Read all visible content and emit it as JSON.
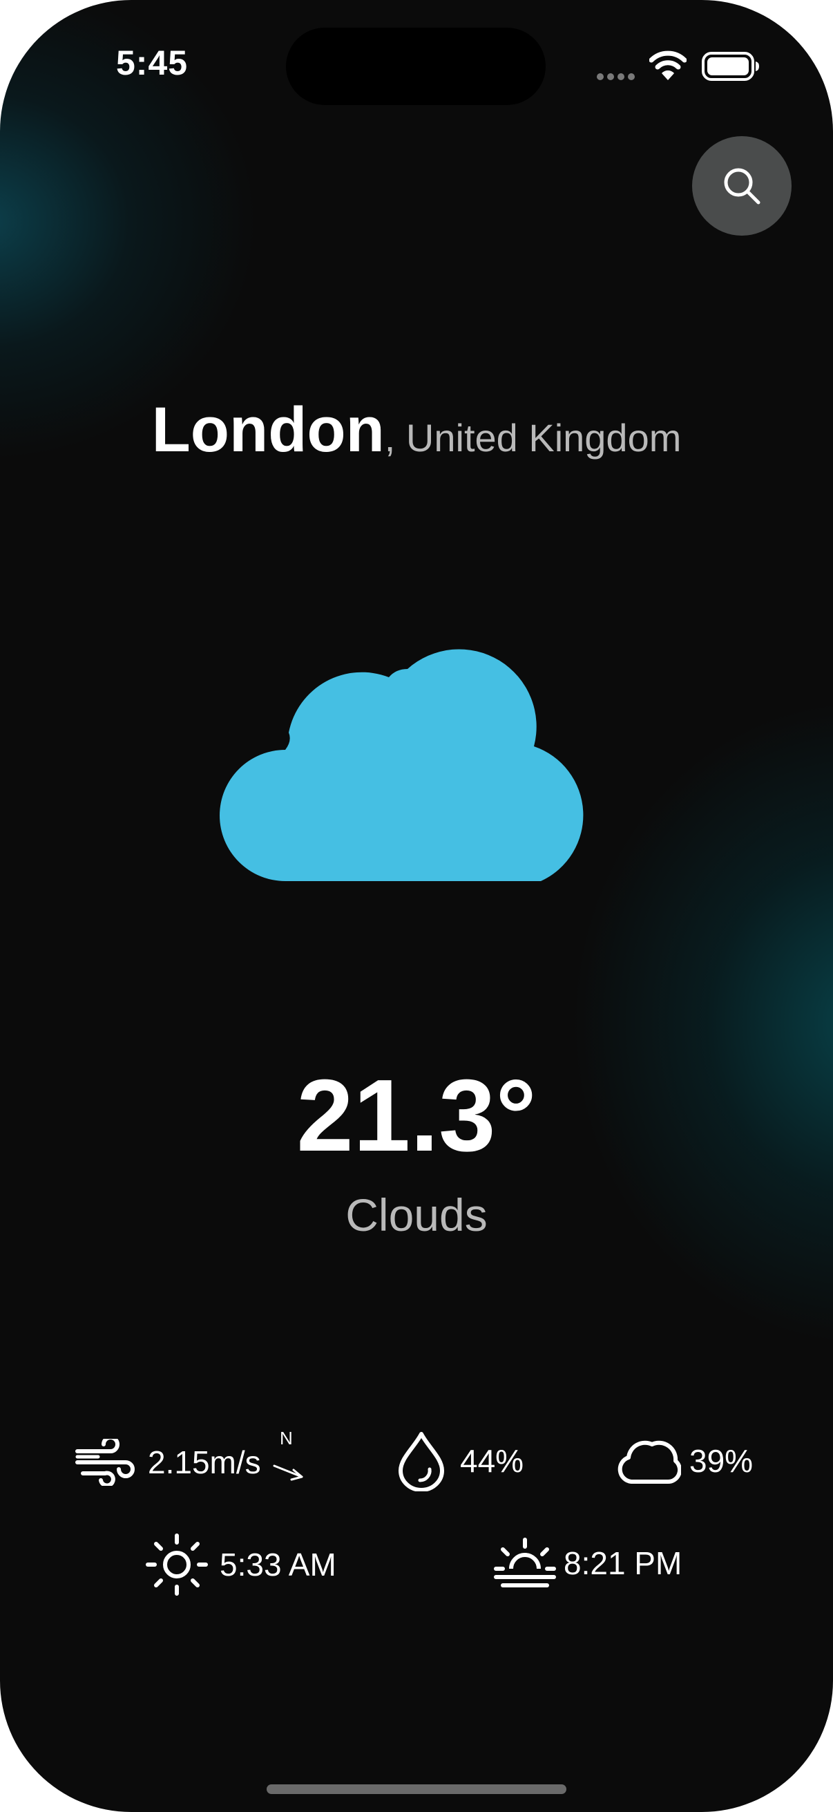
{
  "status_bar": {
    "time": "5:45"
  },
  "search": {
    "icon": "search-icon"
  },
  "location": {
    "city": "London",
    "separator": ",",
    "country": " United Kingdom"
  },
  "weather": {
    "icon": "cloud-icon",
    "temperature": "21.3°",
    "condition": "Clouds"
  },
  "stats": {
    "wind": {
      "icon": "wind-icon",
      "value": "2.15m/s",
      "direction_label": "N"
    },
    "humidity": {
      "icon": "droplet-icon",
      "value": "44%"
    },
    "cloudiness": {
      "icon": "cloud-outline-icon",
      "value": "39%"
    },
    "sunrise": {
      "icon": "sunrise-icon",
      "value": "5:33 AM"
    },
    "sunset": {
      "icon": "sunset-icon",
      "value": "8:21 PM"
    }
  },
  "colors": {
    "background": "#0b0b0b",
    "accent_teal": "#0c4856",
    "cloud": "#45bfe3",
    "search_button": "#4a4c4c",
    "secondary_text": "#b9b9b9"
  }
}
